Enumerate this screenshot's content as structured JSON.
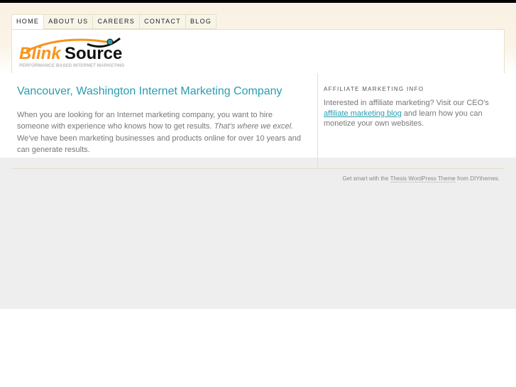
{
  "nav": {
    "tabs": [
      {
        "label": "HOME"
      },
      {
        "label": "ABOUT US"
      },
      {
        "label": "CAREERS"
      },
      {
        "label": "CONTACT"
      },
      {
        "label": "BLOG"
      }
    ]
  },
  "logo": {
    "text_blink": "Blink",
    "text_source": "Source",
    "tagline": "PERFORMANCE BASED INTERNET MARKETING"
  },
  "main": {
    "title": "Vancouver, Washington Internet Marketing Company",
    "body_1": "When you are looking for an Internet marketing company, you want to hire someone with experience who knows how to get results. ",
    "body_em": "That's where we excel.",
    "body_2": " We've have been marketing businesses and products online for over 10 years and can generate results."
  },
  "sidebar": {
    "heading": "Affiliate Marketing Info",
    "text_1": "Interested in affiliate marketing? Visit our CEO's ",
    "link": "affiliate marketing blog",
    "text_2": " and learn how you can monetize your own websites."
  },
  "footer": {
    "text_1": "Get smart with the ",
    "link": "Thesis WordPress Theme",
    "text_2": " from DIYthemes."
  },
  "colors": {
    "accent": "#2a9cb0",
    "orange": "#f7941d"
  }
}
